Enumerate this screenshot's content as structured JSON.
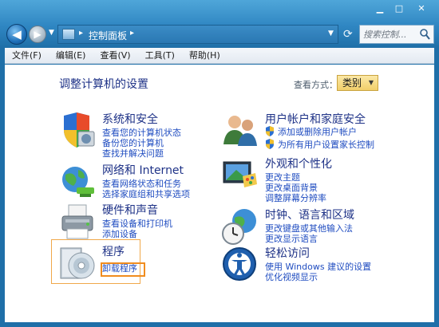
{
  "window": {
    "title": "控制面板",
    "min_glyph": "▁",
    "max_glyph": "□",
    "close_glyph": "✕"
  },
  "nav": {
    "back_glyph": "◀",
    "forward_glyph": "▶",
    "history_glyph": "▼",
    "address_sep": "▸",
    "address_text": "控制面板",
    "address_trailing_sep": "▸",
    "address_drop_glyph": "▼",
    "refresh_glyph": "⟳",
    "search_placeholder": "搜索控制..."
  },
  "menu": [
    {
      "label": "文件(F)"
    },
    {
      "label": "编辑(E)"
    },
    {
      "label": "查看(V)"
    },
    {
      "label": "工具(T)"
    },
    {
      "label": "帮助(H)"
    }
  ],
  "page": {
    "title": "调整计算机的设置",
    "view_by_label": "查看方式：",
    "view_by_value": "类别",
    "view_by_caret": "▼"
  },
  "categories": {
    "system": {
      "title": "系统和安全",
      "icon": "shield-system-icon",
      "links": [
        "查看您的计算机状态",
        "备份您的计算机",
        "查找并解决问题"
      ]
    },
    "network": {
      "title": "网络和 Internet",
      "icon": "network-globe-icon",
      "links": [
        "查看网络状态和任务",
        "选择家庭组和共享选项"
      ]
    },
    "hardware": {
      "title": "硬件和声音",
      "icon": "printer-icon",
      "links": [
        "查看设备和打印机",
        "添加设备"
      ]
    },
    "programs": {
      "title": "程序",
      "icon": "program-disc-icon",
      "links": [
        "卸载程序"
      ]
    },
    "users": {
      "title": "用户帐户和家庭安全",
      "icon": "users-icon",
      "links": [
        "添加或删除用户帐户",
        "为所有用户设置家长控制"
      ]
    },
    "appearance": {
      "title": "外观和个性化",
      "icon": "display-palette-icon",
      "links": [
        "更改主题",
        "更改桌面背景",
        "调整屏幕分辨率"
      ]
    },
    "clock": {
      "title": "时钟、语言和区域",
      "icon": "clock-globe-icon",
      "links": [
        "更改键盘或其他输入法",
        "更改显示语言"
      ]
    },
    "ease": {
      "title": "轻松访问",
      "icon": "ease-of-access-icon",
      "links": [
        "使用 Windows 建议的设置",
        "优化视频显示"
      ]
    }
  },
  "colors": {
    "title_blue": "#1e3287",
    "link_blue": "#1f4cc0",
    "highlight_orange": "#f08c1e"
  }
}
